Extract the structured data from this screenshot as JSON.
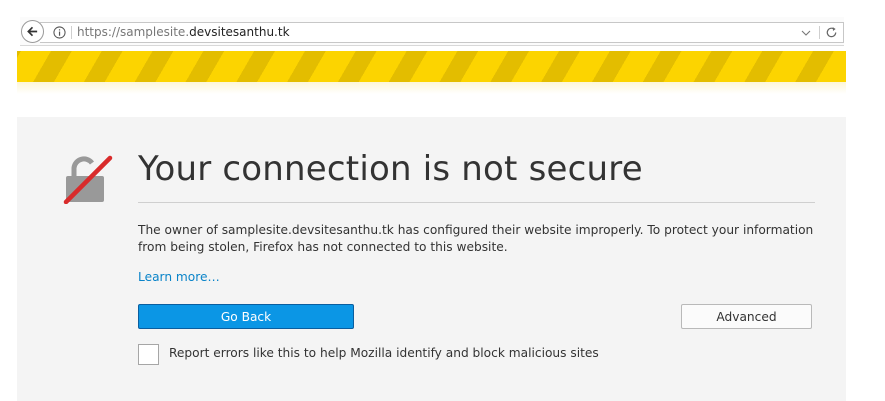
{
  "browser": {
    "url_scheme": "https://",
    "url_subdomain": "samplesite.",
    "url_domain": "devsitesanthu.tk",
    "back_icon": "back-arrow-icon",
    "info_icon": "info-icon",
    "reload_icon": "reload-icon",
    "dropdown_icon": "chevron-down-icon"
  },
  "error": {
    "icon": "broken-lock-icon",
    "title": "Your connection is not secure",
    "description": "The owner of samplesite.devsitesanthu.tk has configured their website improperly. To protect your information from being stolen, Firefox has not connected to this website.",
    "learn_more": "Learn more…",
    "go_back_label": "Go Back",
    "advanced_label": "Advanced",
    "report_checked": false,
    "report_label": "Report errors like this to help Mozilla identify and block malicious sites"
  },
  "colors": {
    "stripe_yellow": "#fcd400",
    "primary_button": "#0b96e5",
    "link": "#0a84c9",
    "lock_strike": "#d92b2b"
  }
}
